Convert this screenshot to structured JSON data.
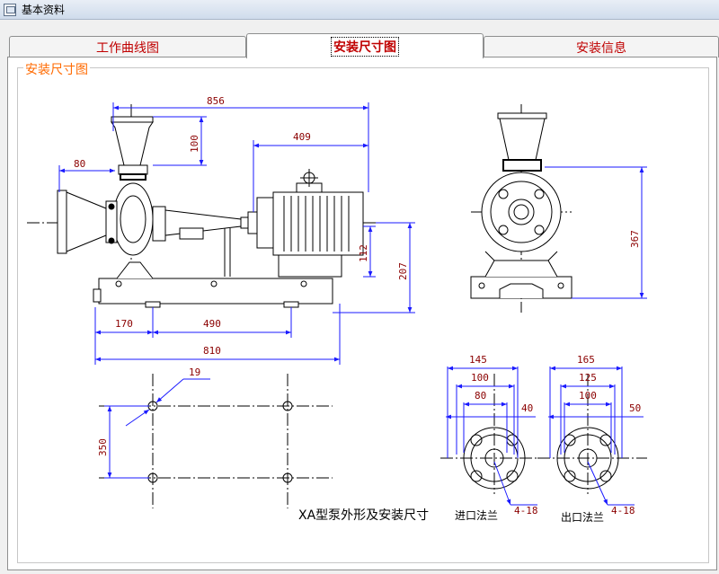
{
  "window": {
    "title": "基本资料",
    "icon": "app-window-icon"
  },
  "tabs": [
    {
      "label": "工作曲线图",
      "active": false
    },
    {
      "label": "安装尺寸图",
      "active": true
    },
    {
      "label": "安装信息",
      "active": false
    }
  ],
  "group": {
    "legend": "安装尺寸图"
  },
  "drawing": {
    "dims": {
      "d856": "856",
      "d409": "409",
      "d100": "100",
      "d80": "80",
      "d112": "112",
      "d207": "207",
      "d367": "367",
      "d170": "170",
      "d490": "490",
      "d810": "810",
      "d19": "19",
      "d350": "350",
      "inlet_145": "145",
      "inlet_100": "100",
      "inlet_80": "80",
      "inlet_40": "40",
      "inlet_holes": "4-18",
      "outlet_165": "165",
      "outlet_125": "125",
      "outlet_100": "100",
      "outlet_50": "50",
      "outlet_holes": "4-18"
    },
    "caption": "XA型泵外形及安装尺寸",
    "inlet_label": "进口法兰",
    "outlet_label": "出口法兰"
  },
  "colors": {
    "dimension": "#1a1aff",
    "dim_text": "#8b0000",
    "tab_text": "#c00000",
    "legend": "#ff6a00"
  }
}
